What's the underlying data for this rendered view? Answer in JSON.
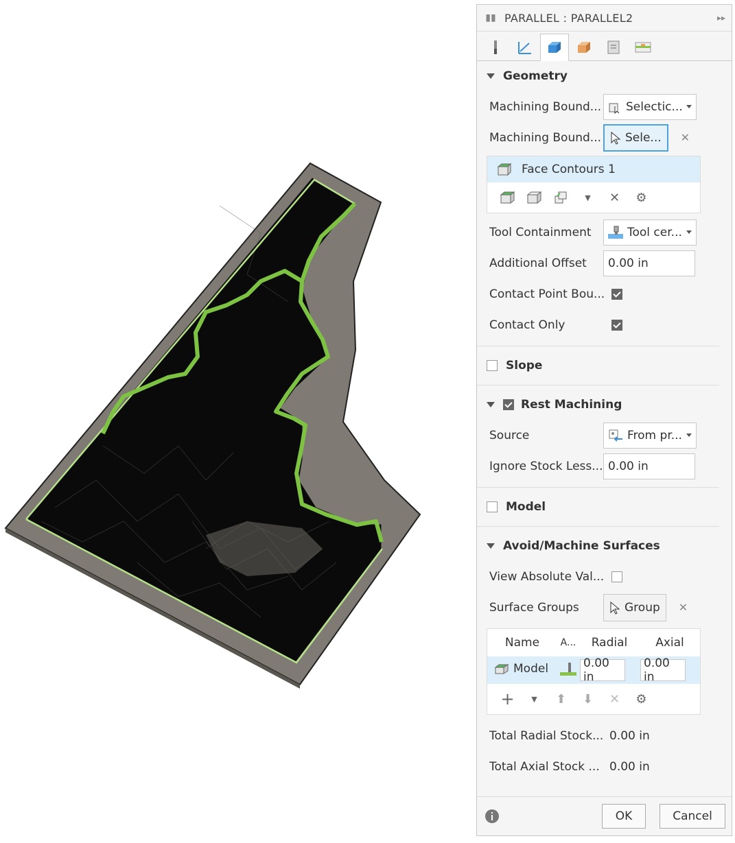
{
  "panel": {
    "title": "PARALLEL : PARALLEL2",
    "tabs": [
      "tool-tab",
      "heights-tab",
      "geometry-tab",
      "passes-tab",
      "linking-tab",
      "post-tab"
    ],
    "geometry": {
      "heading": "Geometry",
      "boundary_mode_label": "Machining Bound...",
      "boundary_mode_value": "Selectic...",
      "boundary_sel_label": "Machining Bound...",
      "boundary_sel_button": "Sele...",
      "selection_item": "Face Contours 1",
      "tool_containment_label": "Tool Containment",
      "tool_containment_value": "Tool cer...",
      "additional_offset_label": "Additional Offset",
      "additional_offset_value": "0.00 in",
      "contact_point_label": "Contact Point Bou...",
      "contact_point_checked": true,
      "contact_only_label": "Contact Only",
      "contact_only_checked": true
    },
    "slope": {
      "heading": "Slope",
      "checked": false
    },
    "rest": {
      "heading": "Rest Machining",
      "checked": true,
      "source_label": "Source",
      "source_value": "From pr...",
      "ignore_label": "Ignore Stock Less...",
      "ignore_value": "0.00 in"
    },
    "model": {
      "heading": "Model",
      "checked": false
    },
    "avoid": {
      "heading": "Avoid/Machine Surfaces",
      "view_abs_label": "View Absolute Val...",
      "view_abs_checked": false,
      "surface_groups_label": "Surface Groups",
      "group_button": "Group",
      "columns": {
        "name": "Name",
        "a": "A...",
        "radial": "Radial",
        "axial": "Axial"
      },
      "rows": [
        {
          "name": "Model",
          "radial": "0.00 in",
          "axial": "0.00 in"
        }
      ],
      "total_radial_label": "Total Radial Stock...",
      "total_radial_value": "0.00 in",
      "total_axial_label": "Total Axial Stock ...",
      "total_axial_value": "0.00 in"
    },
    "footer": {
      "ok": "OK",
      "cancel": "Cancel"
    }
  },
  "colors": {
    "accent": "#4aa3df",
    "toolpath_green": "#7dc242",
    "stock_gray": "#7f7a73",
    "mesh_black": "#0a0a0a",
    "selection_bg": "#dceefa"
  }
}
